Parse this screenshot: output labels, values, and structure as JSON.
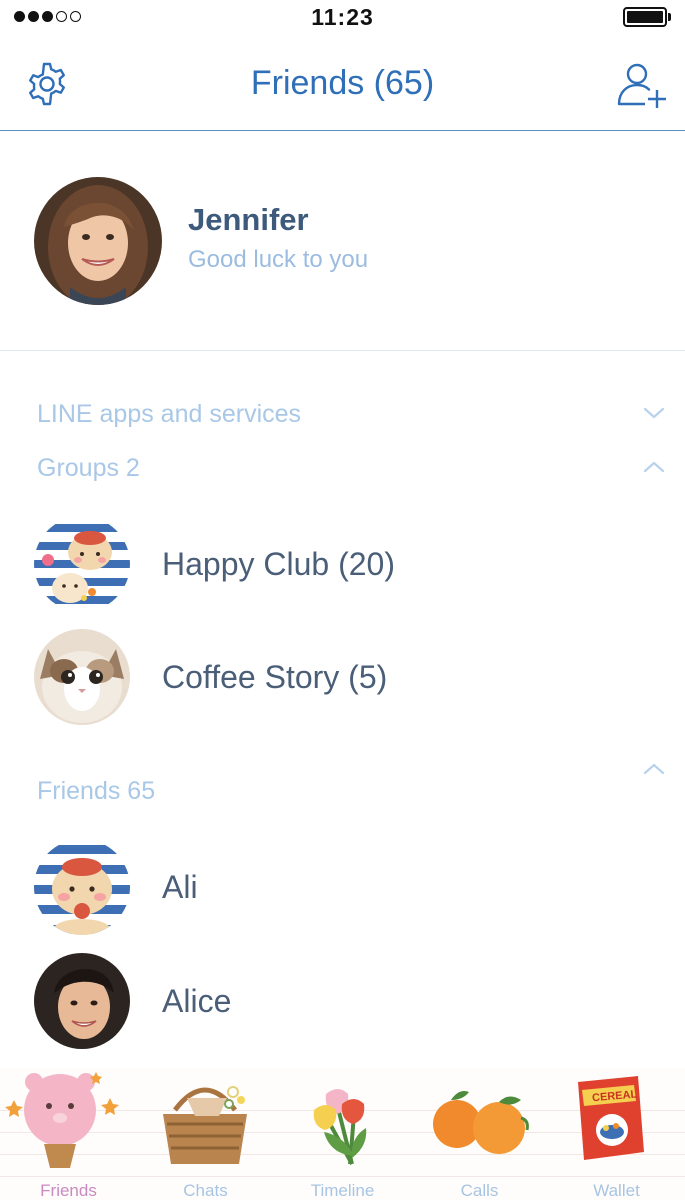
{
  "status_bar": {
    "time": "11:23"
  },
  "header": {
    "title": "Friends (65)"
  },
  "profile": {
    "name": "Jennifer",
    "status": "Good luck to you"
  },
  "sections": {
    "services": "LINE apps and services",
    "groups": "Groups 2",
    "friends": "Friends 65"
  },
  "groups": [
    {
      "name": "Happy Club (20)"
    },
    {
      "name": "Coffee Story (5)"
    }
  ],
  "friends": [
    {
      "name": "Ali"
    },
    {
      "name": "Alice"
    }
  ],
  "tabs": [
    {
      "label": "Friends",
      "icon": "pink-bear-balloon-icon",
      "active": true
    },
    {
      "label": "Chats",
      "icon": "picnic-basket-icon",
      "active": false
    },
    {
      "label": "Timeline",
      "icon": "tulips-icon",
      "active": false
    },
    {
      "label": "Calls",
      "icon": "oranges-icon",
      "active": false
    },
    {
      "label": "Wallet",
      "icon": "cereal-box-icon",
      "active": false
    }
  ],
  "colors": {
    "accent": "#2f6fb7",
    "section_text": "#a9c7e6",
    "active_tab": "#c98ac2"
  }
}
